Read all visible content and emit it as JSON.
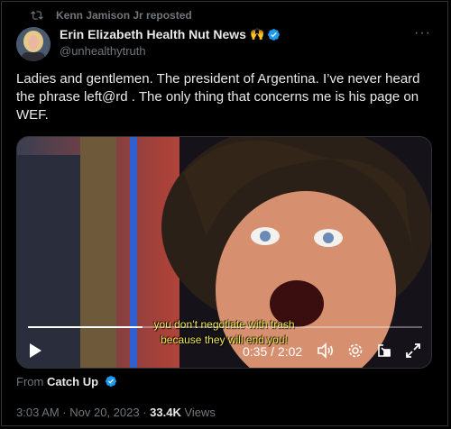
{
  "repost": {
    "text": "Kenn Jamison Jr reposted",
    "icon": "repost-icon"
  },
  "author": {
    "name": "Erin Elizabeth Health Nut News",
    "emoji": "🙌",
    "handle": "@unhealthytruth",
    "verified_color": "#1d9bf0"
  },
  "more_icon": "more-icon",
  "tweet": {
    "text": "Ladies and gentlemen. The president of Argentina. I’ve never heard the phrase left@rd . The only thing that concerns me is his page on WEF."
  },
  "video": {
    "subtitle_line1": "you don’t negotiate with trash",
    "subtitle_line2": "because they will end you!",
    "time": "0:35 / 2:02",
    "progress": 0.29,
    "icons": [
      "play-icon",
      "volume-icon",
      "settings-icon",
      "picture-in-picture-icon",
      "fullscreen-icon"
    ]
  },
  "source": {
    "prefix": "From",
    "name": "Catch Up"
  },
  "meta": {
    "time": "3:03 AM · Nov 20, 2023 · ",
    "views_count": "33.4K",
    "views_label": " Views"
  }
}
